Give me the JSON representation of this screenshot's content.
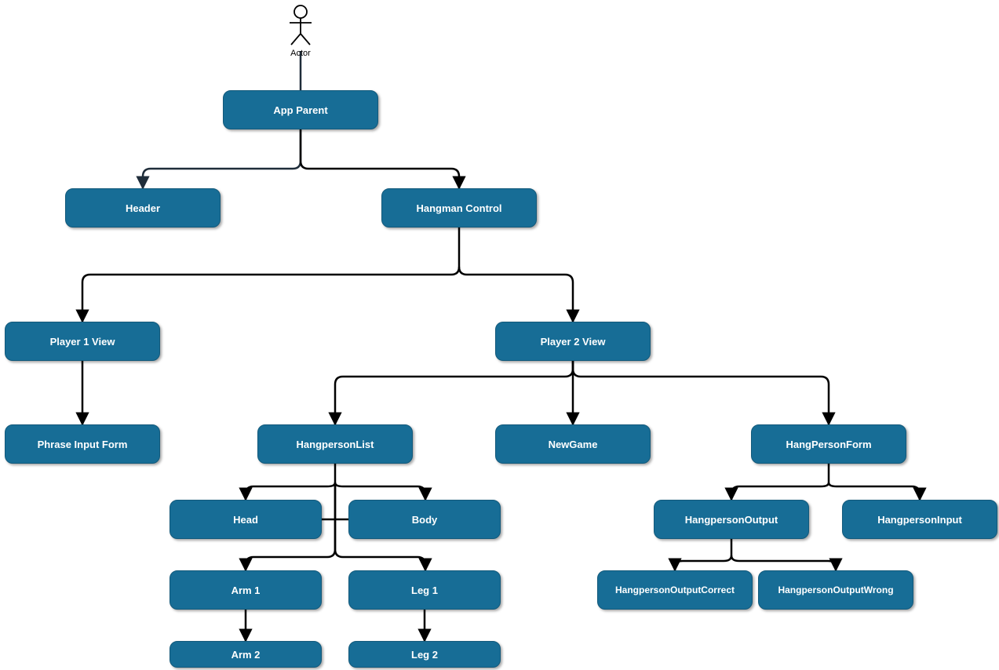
{
  "colors": {
    "node_fill": "#176d96",
    "node_border": "#12597b",
    "edge": "#000000",
    "actor_edge": "#1f2d3a"
  },
  "actor": {
    "label": "Actor"
  },
  "nodes": {
    "app_parent": "App Parent",
    "header": "Header",
    "hangman_control": "Hangman Control",
    "player1_view": "Player 1 View",
    "player2_view": "Player 2 View",
    "phrase_input_form": "Phrase Input Form",
    "hangperson_list": "HangpersonList",
    "new_game": "NewGame",
    "hangperson_form": "HangPersonForm",
    "head": "Head",
    "body": "Body",
    "arm1": "Arm 1",
    "leg1": "Leg 1",
    "arm2": "Arm 2",
    "leg2": "Leg 2",
    "hangperson_output": "HangpersonOutput",
    "hangperson_input": "HangpersonInput",
    "hangperson_output_correct": "HangpersonOutputCorrect",
    "hangperson_output_wrong": "HangpersonOutputWrong"
  }
}
